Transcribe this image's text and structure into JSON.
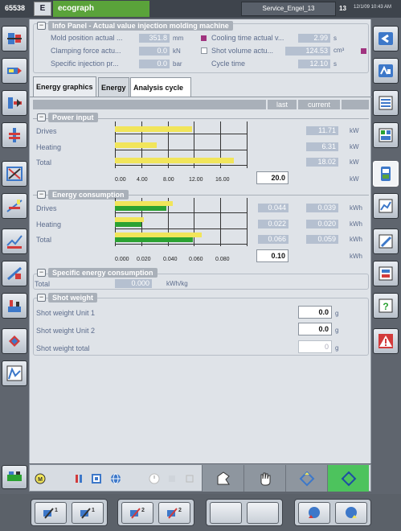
{
  "header": {
    "machine_no": "65538",
    "app_logo": "E",
    "app_name": "ecograph",
    "user": "Service_Engel_13",
    "screen_no": "13",
    "clock": "12/1/09 10:43 AM"
  },
  "info_panel": {
    "title": "Info Panel - Actual value injection molding machine",
    "rows": [
      {
        "label": "Mold position actual ...",
        "value": "351.8",
        "unit": "mm",
        "label2": "Cooling time actual v...",
        "value2": "2.99",
        "unit2": "s"
      },
      {
        "label": "Clamping force actu...",
        "value": "0.0",
        "unit": "kN",
        "label2": "Shot volume actu...",
        "value2": "124.53",
        "unit2": "cm³"
      },
      {
        "label": "Specific injection pr...",
        "value": "0.0",
        "unit": "bar",
        "label2": "Cycle time",
        "value2": "12.10",
        "unit2": "s"
      }
    ]
  },
  "tabs": [
    {
      "label": "Energy graphics",
      "active": true
    },
    {
      "label": "Energy",
      "active": false
    },
    {
      "label": "Analysis cycle",
      "active": false
    }
  ],
  "columns": {
    "last": "last",
    "current": "current"
  },
  "chart_data": [
    {
      "type": "bar",
      "title": "Power input",
      "categories": [
        "Drives",
        "Heating",
        "Total"
      ],
      "series": [
        {
          "name": "current",
          "values": [
            11.71,
            6.31,
            18.02
          ],
          "color": "#f1e55a"
        }
      ],
      "current_values": [
        "11.71",
        "6.31",
        "18.02"
      ],
      "unit": "kW",
      "xlim": [
        0,
        20
      ],
      "ticks": [
        "0.00",
        "4.00",
        "8.00",
        "12.00",
        "16.00"
      ],
      "scale_max": "20.0",
      "scale_unit": "kW"
    },
    {
      "type": "bar",
      "title": "Energy consumption",
      "categories": [
        "Drives",
        "Heating",
        "Total"
      ],
      "series": [
        {
          "name": "last",
          "values": [
            0.044,
            0.022,
            0.066
          ],
          "color": "#f1e55a"
        },
        {
          "name": "current",
          "values": [
            0.039,
            0.02,
            0.059
          ],
          "color": "#2ba232"
        }
      ],
      "last_values": [
        "0.044",
        "0.022",
        "0.066"
      ],
      "current_values": [
        "0.039",
        "0.020",
        "0.059"
      ],
      "unit": "kWh",
      "xlim": [
        0,
        0.1
      ],
      "ticks": [
        "0.000",
        "0.020",
        "0.040",
        "0.060",
        "0.080"
      ],
      "scale_max": "0.10",
      "scale_unit": "kWh"
    }
  ],
  "specific_energy": {
    "title": "Specific energy consumption",
    "label": "Total",
    "value": "0.000",
    "unit": "kWh/kg"
  },
  "shot_weight": {
    "title": "Shot weight",
    "rows": [
      {
        "label": "Shot weight Unit 1",
        "value": "0.0",
        "unit": "g"
      },
      {
        "label": "Shot weight Unit 2",
        "value": "0.0",
        "unit": "g"
      },
      {
        "label": "Shot weight total",
        "value": "0",
        "unit": "g"
      }
    ]
  },
  "icons": {
    "left": [
      "mold-setup-icon",
      "injection-unit-icon",
      "ejector-icon",
      "heating-icon",
      "cores-icon",
      "quality-icon",
      "process-graph-icon",
      "hand-mode-icon",
      "temperature-icon",
      "hydraulic-icon",
      "curve-icon"
    ],
    "right": [
      "back-icon",
      "home-icon",
      "monitor-icon",
      "screen-list-icon",
      "ecograph-icon",
      "datalog-icon",
      "edit-icon",
      "print-icon",
      "help-icon",
      "alarm-icon"
    ]
  },
  "colors": {
    "accent_green": "#5aa33a",
    "bar_yellow": "#f1e55a",
    "bar_green": "#2ba232",
    "value_field": "#b5c0d0",
    "marker": "#a0337f"
  }
}
